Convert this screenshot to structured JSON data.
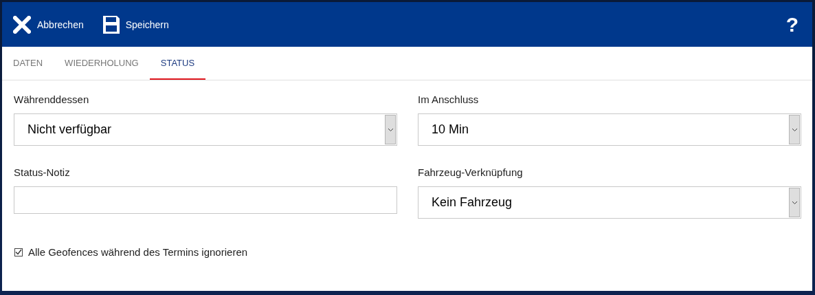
{
  "toolbar": {
    "actions": [
      {
        "kind": "cancel",
        "label": "Abbrechen"
      },
      {
        "kind": "save",
        "label": "Speichern"
      }
    ],
    "help": "?"
  },
  "tabs": [
    {
      "label": "DATEN",
      "selected": false
    },
    {
      "label": "WIEDERHOLUNG",
      "selected": false
    },
    {
      "label": "STATUS",
      "selected": true
    }
  ],
  "fields": [
    {
      "kind": "select",
      "label": "Währenddessen",
      "value": "Nicht verfügbar"
    },
    {
      "kind": "select",
      "label": "Im Anschluss",
      "value": "10 Min"
    },
    {
      "kind": "text",
      "label": "Status-Notiz"
    },
    {
      "kind": "select",
      "label": "Fahrzeug-Verknüpfung",
      "value": "Kein Fahrzeug"
    }
  ],
  "checkbox": {
    "label": "Alle Geofences während des Termins ignorieren",
    "checked": true
  }
}
